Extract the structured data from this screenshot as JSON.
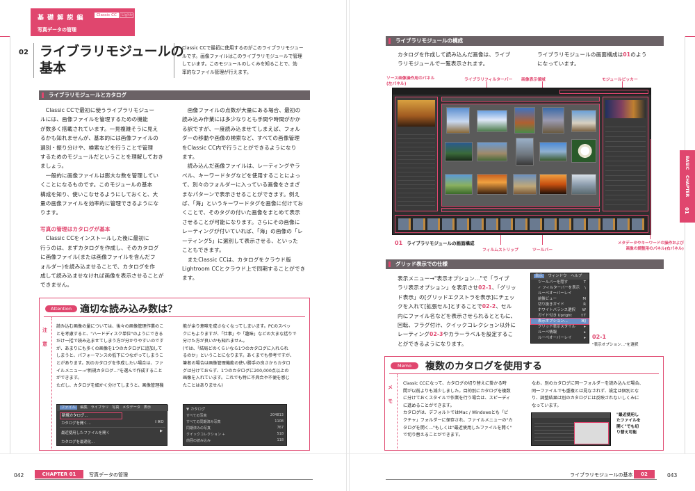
{
  "left_page": {
    "header": {
      "series": "基 礎 解 説 編",
      "badge_classic": "Classic CC",
      "badge_lightroom": "Lightroom CC",
      "subtitle": "写真データの管理"
    },
    "section_number": "02",
    "title_line1": "ライブラリモジュールの",
    "title_line2": "基本",
    "lead": [
      "Classic CCで最初に使用するのがこのライブラリモジュー",
      "ルです。画像ファイルはこのライブラリモジュールで管理",
      "しています。このモジュールのしくみを知ることで、効",
      "率的なファイル管理が行えます。"
    ],
    "section_heading": "ライブラリモジュールとカタログ",
    "col1_para1": [
      "　Classic CCで最初に使うライブラリモジュー",
      "ルには、画像ファイルを管理するための機能",
      "が数多く搭載されています。一見複雑そうに見え",
      "るかも知れませんが、基本的には画像ファイルの",
      "選別・振り分けや、検索などを行うことで管理",
      "するためのモジュールだということを理解しておき",
      "ましょう。",
      "　一般的に画像ファイルは膨大な数を管理してい",
      "くことになるものです。このモジュールの基本",
      "構成を知り、使いこなせるようにしておくと、大",
      "量の画像ファイルを効率的に管理できるようにな",
      "ります。"
    ],
    "subheading": "写真の管理はカタログが基本",
    "col1_para2": [
      "　Classic CCをインストールした後に最初に",
      "行うのは、まずカタログを作成し、そのカタログ",
      "に画像ファイル(または画像ファイルを含んだフ",
      "ォルダー)を読み込ませることで、カタログを作",
      "成して読み込ませなければ画像を表示させることが",
      "できません。"
    ],
    "col2": [
      "　画像ファイルの点数が大量にある場合、最初の",
      "読み込み作業には多少なりとも手間や時間がかか",
      "る訳ですが、一度読み込ませてしまえば、フォル",
      "ダーの移動や画像の検索など、すべての画像管理",
      "をClassic CC内で行うことができるようになり",
      "ます。",
      "　読み込んだ画像ファイルは、レーティングやラ",
      "ベル、キーワードタグなどを使用することによっ",
      "て、別々のフォルダーに入っている画像をさまざ",
      "まなパターンで表示させることができます。例え",
      "ば、「海」というキーワードタグを画像に付けてお",
      "くことで、そのタグの付いた画像をまとめて表示",
      "させることが可能になります。さらにその画像に",
      "レーティングが付いていれば、「海」の画像の「レ",
      "ーティング5」に選別して表示させる、といった",
      "こともできます。",
      "　またClassic CCは、カタログをクラウド版",
      "Lightroom CCとクラウド上で同期することができ",
      "ます。"
    ],
    "attention": {
      "badge": "Attention",
      "title": "適切な読み込み数は？",
      "side_label1": "注",
      "side_label2": "意",
      "col1": [
        "読み込む画像の量については、後々の画像管理作業のこ",
        "とを考慮すると、\"ハードディスク単位\"のようにできる",
        "だけ一括で読み込ませてしまう方が分かりやすいのです",
        "が、あまりにも多くの画像を1つのカタログに追加して",
        "しまうと、パフォーマンスの低下につながってしまうこ",
        "とがあります。別のカタログを作成したい場合は、ファ",
        "イルメニュー→\"新規カタログ...\"を選んで作成すること",
        "ができます。",
        "ただし、カタログを細かく分けてしまうと、画像管理機"
      ],
      "col2": [
        "能が余り意味を成さなくなってしまいます。PCのスペッ",
        "クにもよりますが、「仕事」や「趣味」などの大まな括りで",
        "分けた方が良いかも知れません。",
        "(では、「結局どのくらいなら1つのカタログに入れられ",
        "るのか」ということになります。あくまでも参考ですが、",
        "筆者の場合は画像管理機能の使い勝手の良さからカタロ",
        "グは分けておらず、1つのカタログに200,000点以上の",
        "画像を入れています。これでも特に不具合や不便を感じ",
        "たことはありません)"
      ],
      "file_menu": {
        "bar": [
          "ファイル",
          "編集",
          "ライブラリ",
          "写真",
          "メタデータ",
          "表示"
        ],
        "items": [
          "新規カタログ...",
          "カタログを開く...",
          "最近使用したファイルを開く",
          "カタログを最適化..."
        ],
        "shortcut": "⇧⌘O"
      },
      "catalog_panel": {
        "title": "▼ カタログ",
        "rows": [
          {
            "label": "すべての写真",
            "count": "204813"
          },
          {
            "label": "すべての同期済み写真",
            "count": "1108"
          },
          {
            "label": "同期済みの写真",
            "count": "767"
          },
          {
            "label": "クイックコレクション +",
            "count": "518"
          },
          {
            "label": "前回の読み込み",
            "count": "118"
          }
        ]
      }
    },
    "footer": {
      "page_number": "042",
      "chapter": "CHAPTER 01",
      "chapter_title": "写真データの管理"
    }
  },
  "right_page": {
    "section1_heading": "ライブラリモジュールの構成",
    "intro_left": [
      "カタログを作成して読み込んだ画像は、ライブ",
      "ラリモジュールで一覧表示されます。"
    ],
    "intro_right_prefix": "ライブラリモジュールの画面構成は",
    "intro_right_ref": "01",
    "intro_right_suffix": "のよう",
    "intro_right_line2": "になっています。",
    "labels": {
      "source_panel": "ソース画像操作用のパネル",
      "source_panel_sub": "(左パネル)",
      "filter_bar": "ライブラリフィルターバー",
      "display_area": "画像表示領域",
      "module_picker": "モジュールピッカー",
      "filmstrip": "フィルムストリップ",
      "toolbar": "ツールバー",
      "metadata_line1": "メタデータやキーワードの操作および",
      "metadata_line2": "画像の調整用のパネル(右パネル)"
    },
    "figure_caption_num": "01",
    "figure_caption": "ライブラリモジュールの画面構成",
    "side_tab": {
      "basic": "BASIC",
      "chapter": "CHAPTER",
      "number": "01"
    },
    "section2_heading": "グリッド表示での仕様",
    "grid_text": [
      [
        "表示メニュー→\"表示オプション...\"で「ライブ",
        null
      ],
      [
        "ラリ表示オプション」を表示させ",
        "02-1",
        "、「グリッ"
      ],
      [
        "ド表示」の[グリッドエクストラを表示]にチェッ",
        null
      ],
      [
        "クを入れて[拡張セル]とすることで",
        "02-2",
        "、セル"
      ],
      [
        "内にファイル名などを表示させられるとともに、",
        null
      ],
      [
        "回転、フラグ付け、クイックコレクション以外に",
        null
      ],
      [
        "レーティング",
        "02-3",
        "やカラーラベルを設定するこ"
      ],
      [
        "とができるようになります。",
        null
      ]
    ],
    "view_menu": {
      "bar": [
        "表示",
        "ウィンドウ",
        "ヘルプ"
      ],
      "items": [
        {
          "label": "ツールバーを隠す",
          "key": "T"
        },
        {
          "label": "✓ フィルターバーを表示",
          "key": "\\"
        },
        {
          "label": "ルーペオーバーレイ",
          "key": ""
        },
        {
          "label": "前後ビュー",
          "key": "M"
        },
        {
          "label": "切り抜きガイド",
          "key": "R"
        },
        {
          "label": "ホワイトバランス選択",
          "key": "W"
        },
        {
          "label": "ガイド付き Upright",
          "key": "⇧T"
        },
        {
          "label": "表示オプション...",
          "key": "⌘J"
        },
        {
          "label": "グリッド表示スタイル",
          "key": "▸"
        },
        {
          "label": "ルーペ情報",
          "key": "▸"
        },
        {
          "label": "ルーペオーバーレイ",
          "key": "▸"
        }
      ]
    },
    "menu_caption_num": "02-1",
    "menu_caption": "\"表示オプション...\"を選択",
    "memo": {
      "badge": "Memo",
      "title": "複数のカタログを使用する",
      "side1": "メ",
      "side2": "モ",
      "col1": [
        "Classic CCになって、カタログの切り替えに掛かる時",
        "間が以前よりも減少しました。目的別にカタログを複数",
        "に分けておくスタイルで作業を行う場合は、スピーディ",
        "に進めることができます。",
        "カタログは、デフォルトではMac / Windowsとも「ピ",
        "クチャ」フォルダーに保存され、ファイルメニューの\"カ",
        "タログを開く...\"もしくは\"最近使用したファイルを開く\"",
        "で切り替えることができます。"
      ],
      "col2": [
        "なお、別のカタログに同一フォルダーを読み込んだ場合、",
        "同一ファイルでも重複とは見なされず、設定は個別とな",
        "り、調整結果は別のカタログには反映されないしくみに",
        "なっています。"
      ],
      "note": [
        "\"最近使用し",
        "たファイルを",
        "開く\"でも切",
        "り替え可能"
      ]
    },
    "footer": {
      "section_title": "ライブラリモジュールの基本",
      "section_number": "02",
      "page_number": "043"
    }
  },
  "colors": {
    "accent": "#e0466e",
    "bar": "#6b6266",
    "dark_ui": "#2f2f2f"
  }
}
